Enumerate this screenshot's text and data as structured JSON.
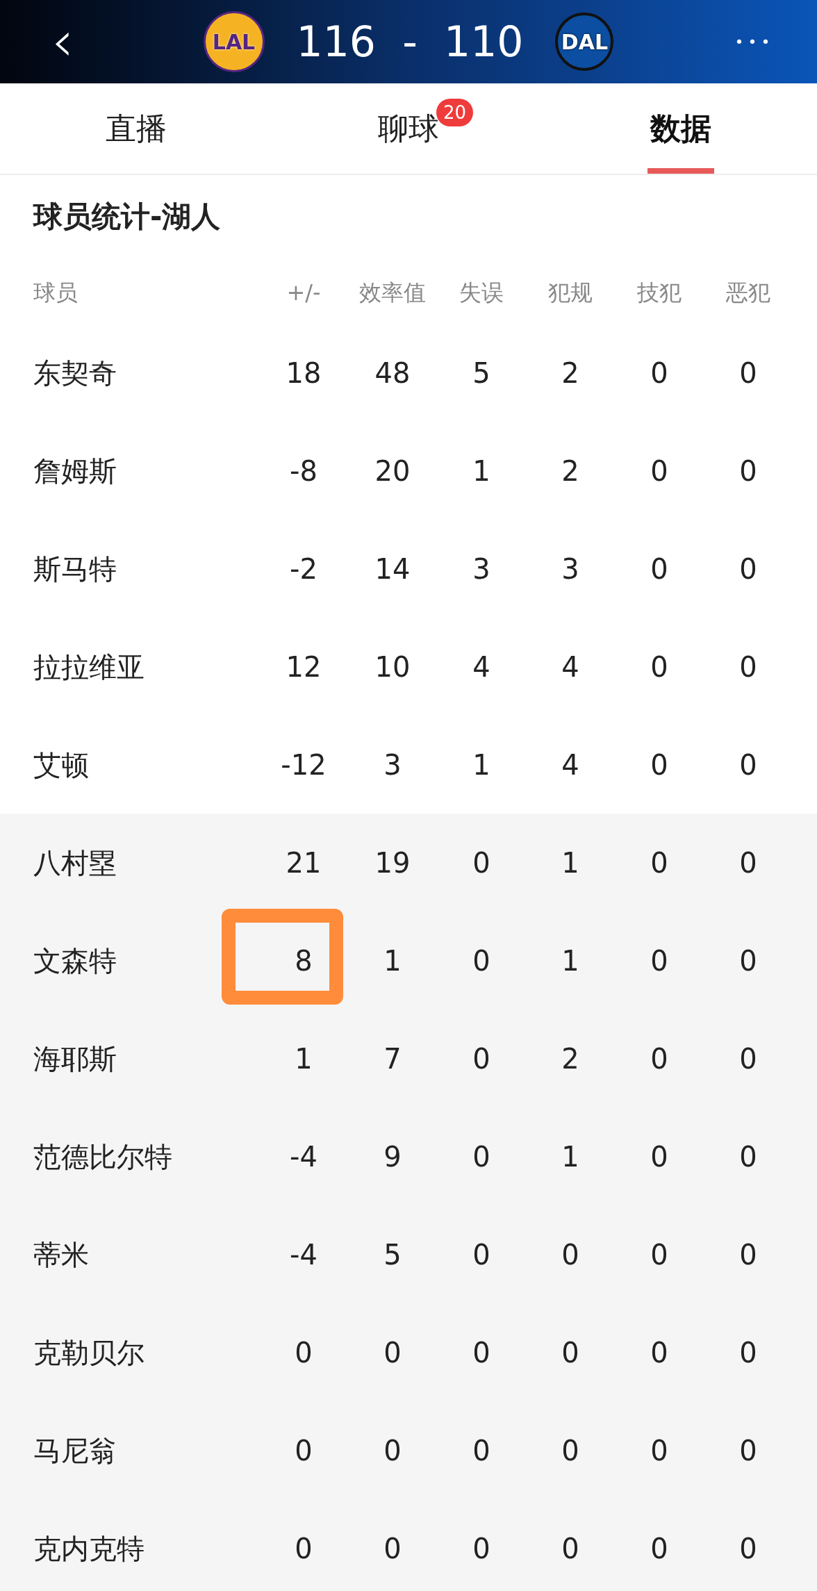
{
  "header": {
    "back": "‹",
    "home_logo": "LAL",
    "score": "116  -  110",
    "away_logo": "DAL",
    "more": "•••"
  },
  "tabs": [
    {
      "label": "直播",
      "selected": false
    },
    {
      "label": "聊球",
      "selected": false,
      "badge": "20"
    },
    {
      "label": "数据",
      "selected": true
    }
  ],
  "section_title": "球员统计-湖人",
  "table": {
    "columns": [
      "球员",
      "+/-",
      "效率值",
      "失误",
      "犯规",
      "技犯",
      "恶犯"
    ],
    "starter_rows": [
      {
        "cells": [
          "东契奇",
          "18",
          "48",
          "5",
          "2",
          "0",
          "0"
        ]
      },
      {
        "cells": [
          "詹姆斯",
          "-8",
          "20",
          "1",
          "2",
          "0",
          "0"
        ]
      },
      {
        "cells": [
          "斯马特",
          "-2",
          "14",
          "3",
          "3",
          "0",
          "0"
        ]
      },
      {
        "cells": [
          "拉拉维亚",
          "12",
          "10",
          "4",
          "4",
          "0",
          "0"
        ]
      },
      {
        "cells": [
          "艾顿",
          "-12",
          "3",
          "1",
          "4",
          "0",
          "0"
        ]
      }
    ],
    "bench_rows": [
      {
        "cells": [
          "八村塁",
          "21",
          "19",
          "0",
          "1",
          "0",
          "0"
        ]
      },
      {
        "highlighted": true,
        "cells": [
          "文森特",
          "8",
          "1",
          "0",
          "1",
          "0",
          "0"
        ]
      },
      {
        "cells": [
          "海耶斯",
          "1",
          "7",
          "0",
          "2",
          "0",
          "0"
        ]
      },
      {
        "cells": [
          "范德比尔特",
          "-4",
          "9",
          "0",
          "1",
          "0",
          "0"
        ]
      },
      {
        "cells": [
          "蒂米",
          "-4",
          "5",
          "0",
          "0",
          "0",
          "0"
        ]
      },
      {
        "cells": [
          "克勒贝尔",
          "0",
          "0",
          "0",
          "0",
          "0",
          "0"
        ]
      },
      {
        "cells": [
          "马尼翁",
          "0",
          "0",
          "0",
          "0",
          "0",
          "0"
        ]
      },
      {
        "cells": [
          "克内克特",
          "0",
          "0",
          "0",
          "0",
          "0",
          "0"
        ]
      }
    ]
  }
}
